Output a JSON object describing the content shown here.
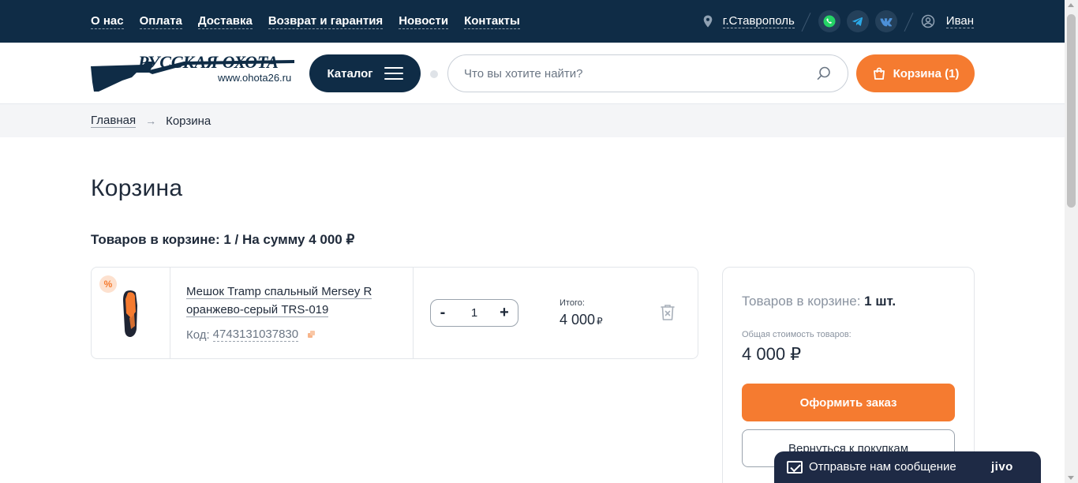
{
  "topbar": {
    "nav": [
      "О нас",
      "Оплата",
      "Доставка",
      "Возврат и гарантия",
      "Новости",
      "Контакты"
    ],
    "city": "г.Ставрополь",
    "user": "Иван"
  },
  "header": {
    "logo_brand": "РУССКАЯ ОХОТА",
    "logo_site": "www.ohota26.ru",
    "catalog_label": "Каталог",
    "search_placeholder": "Что вы хотите найти?",
    "cart_label": "Корзина (1)"
  },
  "breadcrumb": {
    "home": "Главная",
    "current": "Корзина"
  },
  "page": {
    "title": "Корзина",
    "summary": "Товаров в корзине: 1 / На сумму 4 000 ₽"
  },
  "item": {
    "badge": "%",
    "name": "Мешок Tramp спальный Mersey R оранжево-серый TRS-019",
    "code_label": "Код:",
    "code": "4743131037830",
    "qty_minus": "-",
    "qty_value": "1",
    "qty_plus": "+",
    "total_label": "Итого:",
    "total_value": "4 000",
    "currency": "₽"
  },
  "sidebar": {
    "count_label": "Товаров в корзине:",
    "count_value": "1 шт.",
    "sum_label": "Общая стоимость товаров:",
    "sum_value": "4 000 ₽",
    "order_button": "Оформить заказ",
    "back_button": "Вернуться к покупкам"
  },
  "chat": {
    "message": "Отправьте нам сообщение",
    "brand": "jivo"
  },
  "colors": {
    "navy": "#0f2c46",
    "accent_orange": "#f57b30"
  }
}
